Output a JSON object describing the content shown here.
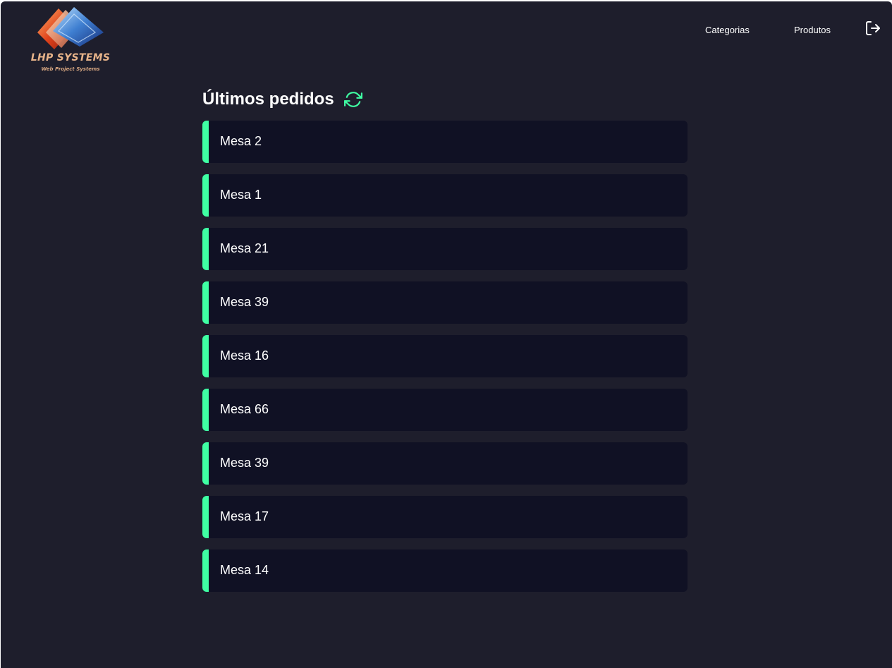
{
  "brand": {
    "name": "LHP SYSTEMS",
    "tagline": "Web Project Systems",
    "logo_icon": "stacked-diamonds-logo"
  },
  "nav": {
    "categorias": "Categorias",
    "produtos": "Produtos",
    "logout_icon": "sign-out-icon"
  },
  "main": {
    "title": "Últimos pedidos",
    "refresh_icon": "refresh-icon",
    "orders": [
      "Mesa 2",
      "Mesa 1",
      "Mesa 21",
      "Mesa 39",
      "Mesa 16",
      "Mesa 66",
      "Mesa 39",
      "Mesa 17",
      "Mesa 14"
    ]
  },
  "colors": {
    "background": "#1e1e2c",
    "card": "#101124",
    "accent": "#3fffa3",
    "text": "#ffffff",
    "brand_text": "#e8b48a"
  }
}
